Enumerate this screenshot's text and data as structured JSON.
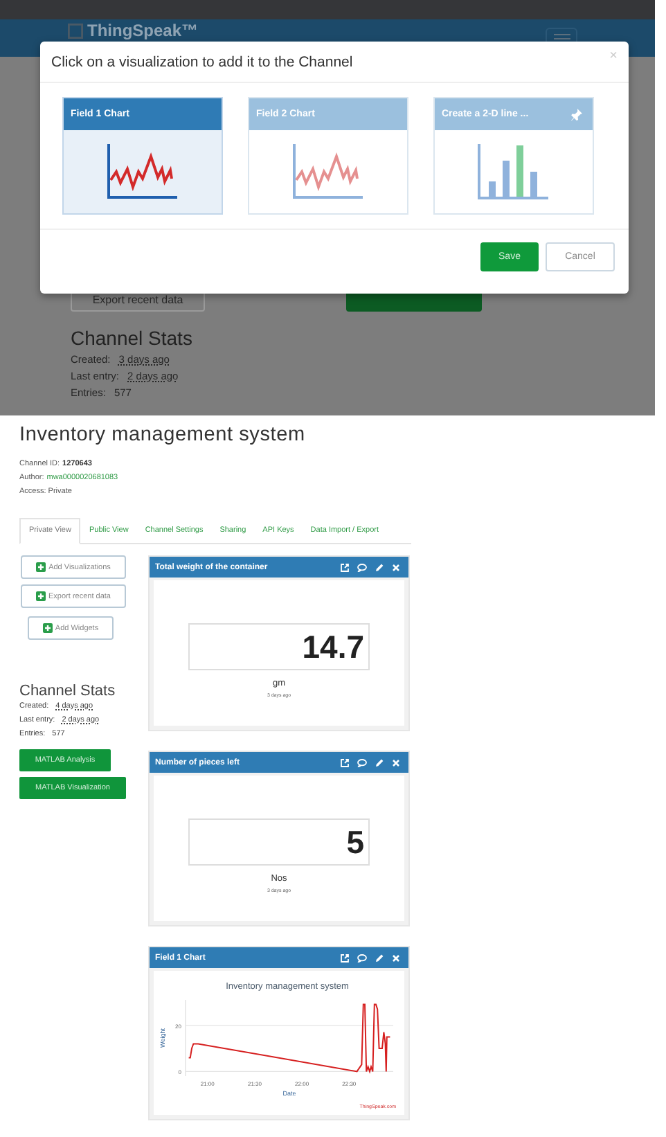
{
  "backdrop": {
    "brand": "ThingSpeak™",
    "export_button": "Export recent data",
    "stats_title": "Channel Stats",
    "stats": [
      {
        "label": "Created:",
        "value": "3 days ago",
        "underlined": true
      },
      {
        "label": "Last entry:",
        "value": "2 days ago",
        "underlined": true
      },
      {
        "label": "Entries:",
        "value": "577",
        "underlined": false
      }
    ]
  },
  "modal": {
    "title": "Click on a visualization to add it to the Channel",
    "close": "×",
    "cards": [
      {
        "title": "Field 1 Chart",
        "kind": "line",
        "selected": true,
        "pinned": false
      },
      {
        "title": "Field 2 Chart",
        "kind": "line",
        "selected": false,
        "pinned": false
      },
      {
        "title": "Create a 2-D line ...",
        "kind": "bar",
        "selected": false,
        "pinned": true
      }
    ],
    "buttons": [
      {
        "label": "Save",
        "kind": "primary"
      },
      {
        "label": "Cancel",
        "kind": "default"
      }
    ]
  },
  "channel": {
    "title": "Inventory management system",
    "id_label": "Channel ID:",
    "id": "1270643",
    "author_label": "Author:",
    "author": "mwa0000020681083",
    "access": "Access: Private"
  },
  "tabs": [
    {
      "label": "Private View",
      "selected": true
    },
    {
      "label": "Public View",
      "selected": false
    },
    {
      "label": "Channel Settings",
      "selected": false
    },
    {
      "label": "Sharing",
      "selected": false
    },
    {
      "label": "API Keys",
      "selected": false
    },
    {
      "label": "Data Import / Export",
      "selected": false
    }
  ],
  "actions": [
    "Add Visualizations",
    "Export recent data",
    "Add Widgets"
  ],
  "stats_title": "Channel Stats",
  "stats": [
    {
      "label": "Created:",
      "value": "4 days ago",
      "underlined": true
    },
    {
      "label": "Last entry:",
      "value": "2 days ago",
      "underlined": true
    },
    {
      "label": "Entries:",
      "value": "577",
      "underlined": false
    }
  ],
  "matlab_buttons": [
    "MATLAB Analysis",
    "MATLAB Visualization"
  ],
  "widgets": [
    {
      "title": "Total weight of the container",
      "kind": "numeric",
      "value": "14.7",
      "unit": "gm",
      "time": "3 days ago"
    },
    {
      "title": "Number of pieces left",
      "kind": "numeric",
      "value": "5",
      "unit": "Nos",
      "time": "3 days ago"
    },
    {
      "title": "Field 1 Chart",
      "kind": "chart",
      "credit": "ThingSpeak.com",
      "chart_data": {
        "type": "line",
        "title": "Inventory management system",
        "xlabel": "Date",
        "ylabel": "Weight",
        "x": [
          20.8,
          20.817,
          20.833,
          20.85,
          20.867,
          20.9,
          22.583,
          22.633,
          22.65,
          22.667,
          22.683,
          22.7,
          22.717,
          22.733,
          22.75,
          22.767,
          22.783,
          22.8,
          22.817,
          22.833,
          22.85,
          22.867,
          22.883,
          22.892,
          22.9,
          22.917,
          22.933
        ],
        "series": [
          {
            "color": "#d62020",
            "values": [
              6,
              6,
              10,
              12,
              12,
              12,
              0,
              3,
              29,
              29,
              0,
              2,
              0,
              2,
              0,
              29,
              29,
              27,
              10,
              10,
              10,
              17,
              12,
              0,
              15,
              15,
              15
            ]
          }
        ],
        "xlim": [
          20.767,
          22.967
        ],
        "ylim": [
          -2,
          31
        ],
        "xticks": [
          {
            "value": 21,
            "label": "21:00"
          },
          {
            "value": 21.5,
            "label": "21:30"
          },
          {
            "value": 22,
            "label": "22:00"
          },
          {
            "value": 22.5,
            "label": "22:30"
          }
        ],
        "yticks": [
          0,
          20
        ]
      }
    }
  ]
}
